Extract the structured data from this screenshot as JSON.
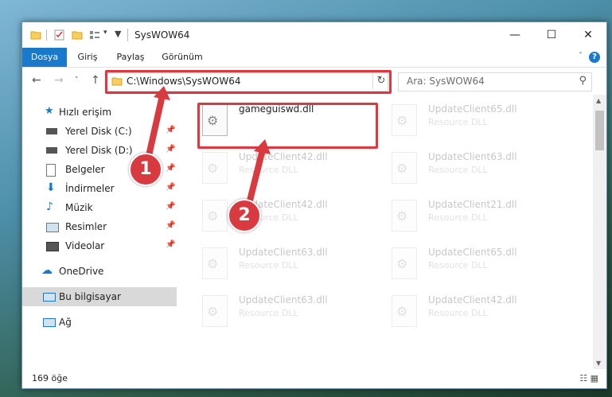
{
  "window": {
    "title": "SysWOW64",
    "minimize": "—",
    "maximize": "☐",
    "close": "✕"
  },
  "ribbon": {
    "tabs": [
      "Dosya",
      "Giriş",
      "Paylaş",
      "Görünüm"
    ],
    "active_tab": "Dosya"
  },
  "address": {
    "path": "C:\\Windows\\SysWOW64",
    "search_placeholder": "Ara: SysWOW64"
  },
  "nav": {
    "quick_access": "Hızlı erişim",
    "items": [
      {
        "label": "Yerel Disk (C:)",
        "pinned": true
      },
      {
        "label": "Yerel Disk (D:)",
        "pinned": true
      },
      {
        "label": "Belgeler",
        "pinned": true
      },
      {
        "label": "İndirmeler",
        "pinned": true
      },
      {
        "label": "Müzik",
        "pinned": true
      },
      {
        "label": "Resimler",
        "pinned": true
      },
      {
        "label": "Videolar",
        "pinned": true
      }
    ],
    "onedrive": "OneDrive",
    "this_pc": "Bu bilgisayar",
    "network": "Ağ"
  },
  "files": {
    "highlighted": {
      "name": "gameguiswd.dll"
    },
    "left_column": [
      {
        "name": "UpdateClient42.dll",
        "type": "Resource DLL"
      },
      {
        "name": "UpdateClient42.dll",
        "type": "Resource DLL"
      },
      {
        "name": "UpdateClient63.dll",
        "type": "Resource DLL"
      },
      {
        "name": "UpdateClient63.dll",
        "type": "Resource DLL"
      }
    ],
    "right_column": [
      {
        "name": "UpdateClient65.dll",
        "type": "Resource DLL"
      },
      {
        "name": "UpdateClient63.dll",
        "type": "Resource DLL"
      },
      {
        "name": "UpdateClient21.dll",
        "type": "Resource DLL"
      },
      {
        "name": "UpdateClient65.dll",
        "type": "Resource DLL"
      },
      {
        "name": "UpdateClient42.dll",
        "type": "Resource DLL"
      }
    ]
  },
  "status": {
    "count": "169 öğe"
  },
  "annotations": {
    "marker1": "1",
    "marker2": "2"
  },
  "colors": {
    "accent": "#1979ca",
    "highlight_red": "#e0363d"
  }
}
